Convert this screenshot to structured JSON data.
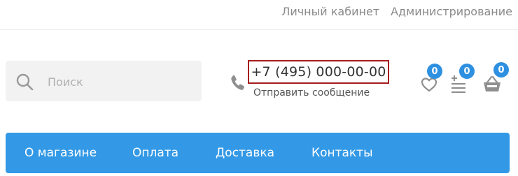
{
  "header": {
    "top_links": [
      {
        "label": "Личный кабинет"
      },
      {
        "label": "Администрирование"
      }
    ]
  },
  "search": {
    "placeholder": "Поиск",
    "icon": "search-icon"
  },
  "contact": {
    "phone": "+7 (495) 000-00-00",
    "send_message": "Отправить сообщение",
    "icon": "phone-icon",
    "highlight_color": "#a51d1d"
  },
  "actions": {
    "favorites": {
      "icon": "heart-icon",
      "count": "0"
    },
    "compare": {
      "icon": "compare-list-icon",
      "count": "0"
    },
    "cart": {
      "icon": "basket-icon",
      "count": "0"
    },
    "badge_color": "#2e90e0"
  },
  "nav": {
    "background": "#3399e6",
    "items": [
      {
        "label": "О магазине"
      },
      {
        "label": "Оплата"
      },
      {
        "label": "Доставка"
      },
      {
        "label": "Контакты"
      }
    ]
  }
}
